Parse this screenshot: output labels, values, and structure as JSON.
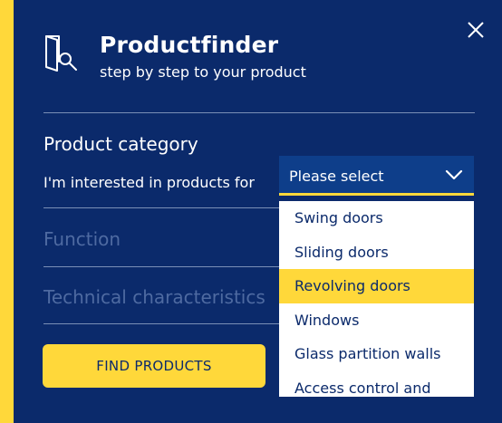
{
  "header": {
    "title": "Productfinder",
    "subtitle": "step by step to your product"
  },
  "form": {
    "category_title": "Product category",
    "interest_label": "I'm interested in products for",
    "select": {
      "value": "Please select"
    },
    "function_label": "Function",
    "technical_label": "Technical characteristics"
  },
  "dropdown": {
    "options": [
      "Swing doors",
      "Sliding doors",
      "Revolving doors",
      "Windows",
      "Glass partition walls",
      "Access control and"
    ],
    "highlighted": "Revolving doors"
  },
  "actions": {
    "find_label": "FIND PRODUCTS"
  },
  "colors": {
    "background": "#0b2a6b",
    "accent": "#ffd83a",
    "select_bg": "#0e3e8a",
    "muted_text": "#4e6aa1"
  },
  "icons": {
    "header": "door-search-icon",
    "close": "close-icon",
    "select": "chevron-down-icon"
  }
}
